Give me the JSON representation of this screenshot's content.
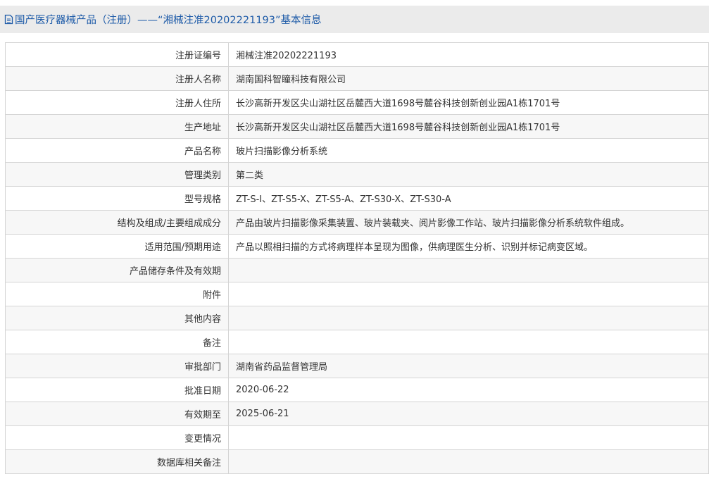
{
  "title": "国产医疗器械产品（注册）——“湘械注准20202221193”基本信息",
  "rows": [
    {
      "label": "注册证编号",
      "value": "湘械注准20202221193"
    },
    {
      "label": "注册人名称",
      "value": "湖南国科智瞳科技有限公司"
    },
    {
      "label": "注册人住所",
      "value": "长沙高新开发区尖山湖社区岳麓西大道1698号麓谷科技创新创业园A1栋1701号"
    },
    {
      "label": "生产地址",
      "value": "长沙高新开发区尖山湖社区岳麓西大道1698号麓谷科技创新创业园A1栋1701号"
    },
    {
      "label": "产品名称",
      "value": "玻片扫描影像分析系统"
    },
    {
      "label": "管理类别",
      "value": "第二类"
    },
    {
      "label": "型号规格",
      "value": "ZT-S-I、ZT-S5-X、ZT-S5-A、ZT-S30-X、ZT-S30-A"
    },
    {
      "label": "结构及组成/主要组成成分",
      "value": "产品由玻片扫描影像采集装置、玻片装载夹、阅片影像工作站、玻片扫描影像分析系统软件组成。"
    },
    {
      "label": "适用范围/预期用途",
      "value": "产品以照相扫描的方式将病理样本呈现为图像，供病理医生分析、识别并标记病变区域。"
    },
    {
      "label": "产品储存条件及有效期",
      "value": ""
    },
    {
      "label": "附件",
      "value": ""
    },
    {
      "label": "其他内容",
      "value": ""
    },
    {
      "label": "备注",
      "value": ""
    },
    {
      "label": "审批部门",
      "value": "湖南省药品监督管理局"
    },
    {
      "label": "批准日期",
      "value": "2020-06-22"
    },
    {
      "label": "有效期至",
      "value": "2025-06-21"
    },
    {
      "label": "变更情况",
      "value": ""
    },
    {
      "label": "数据库相关备注",
      "value": ""
    }
  ]
}
